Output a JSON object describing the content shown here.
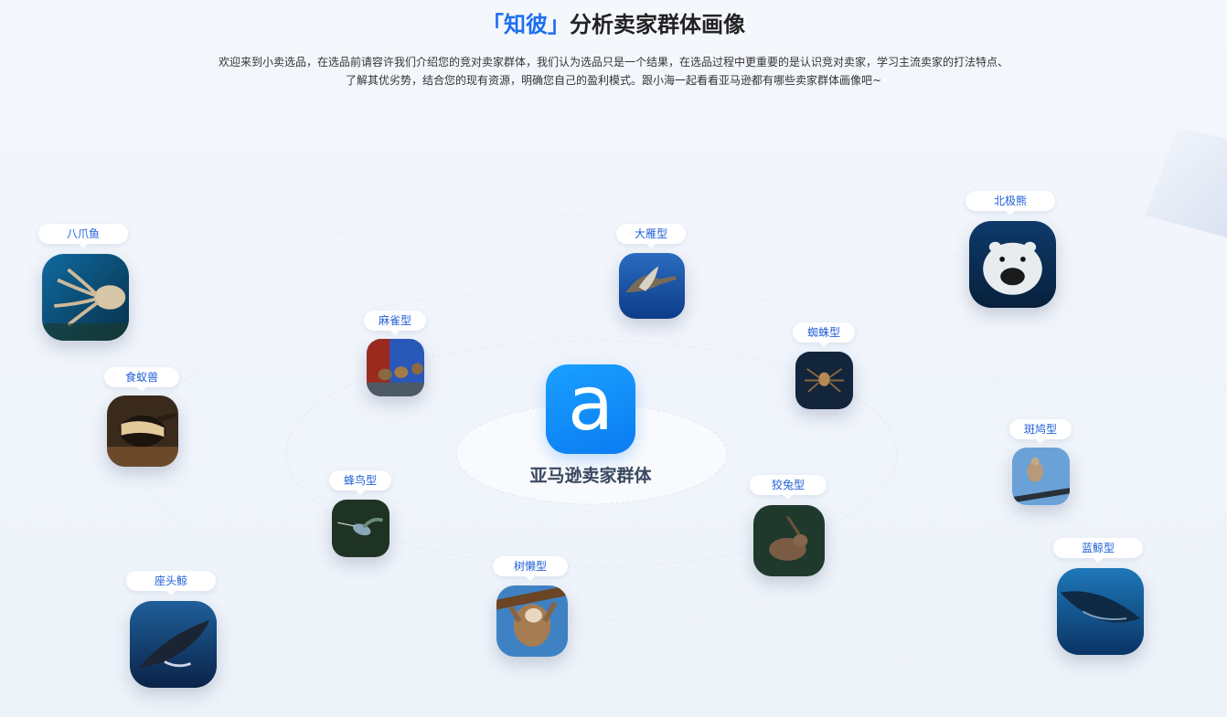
{
  "header": {
    "title_accent": "「知彼」",
    "title_rest": "分析卖家群体画像",
    "intro_line1": "欢迎来到小卖选品，在选品前请容许我们介绍您的竞对卖家群体，我们认为选品只是一个结果，在选品过程中更重要的是认识竞对卖家，学习主流卖家的打法特点、",
    "intro_line2": "了解其优劣势，结合您的现有资源，明确您自己的盈利模式。跟小海一起看看亚马逊都有哪些卖家群体画像吧~"
  },
  "center": {
    "logo_letter": "a",
    "label": "亚马逊卖家群体"
  },
  "groups": [
    {
      "id": "octopus",
      "label": "八爪鱼",
      "icon": "octopus-image"
    },
    {
      "id": "anteater",
      "label": "食蚁兽",
      "icon": "anteater-image"
    },
    {
      "id": "humpback",
      "label": "座头鲸",
      "icon": "humpback-whale-image"
    },
    {
      "id": "sparrow",
      "label": "麻雀型",
      "icon": "sparrow-image"
    },
    {
      "id": "hummingbird",
      "label": "蜂鸟型",
      "icon": "hummingbird-image"
    },
    {
      "id": "goose",
      "label": "大雁型",
      "icon": "goose-image"
    },
    {
      "id": "sloth",
      "label": "树懒型",
      "icon": "sloth-image"
    },
    {
      "id": "spider",
      "label": "蜘蛛型",
      "icon": "spider-image"
    },
    {
      "id": "rabbit",
      "label": "狡兔型",
      "icon": "rabbit-image"
    },
    {
      "id": "polarbear",
      "label": "北极熊",
      "icon": "polar-bear-image"
    },
    {
      "id": "dove",
      "label": "斑鸠型",
      "icon": "dove-image"
    },
    {
      "id": "bluewhale",
      "label": "蓝鲸型",
      "icon": "blue-whale-image"
    }
  ]
}
